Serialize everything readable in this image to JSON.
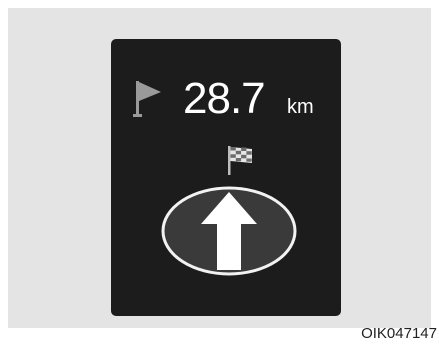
{
  "display": {
    "distance_value": "28.7",
    "distance_unit": "km",
    "start_flag_icon": "start-flag-icon",
    "destination_flag_icon": "checkered-flag-icon",
    "direction_icon": "straight-ahead-arrow-icon"
  },
  "image_code": "OIK047147",
  "colors": {
    "panel_background": "#e4e4e4",
    "display_background": "#1c1c1c",
    "text": "#ffffff",
    "icon_gray": "#9a9a9a"
  }
}
